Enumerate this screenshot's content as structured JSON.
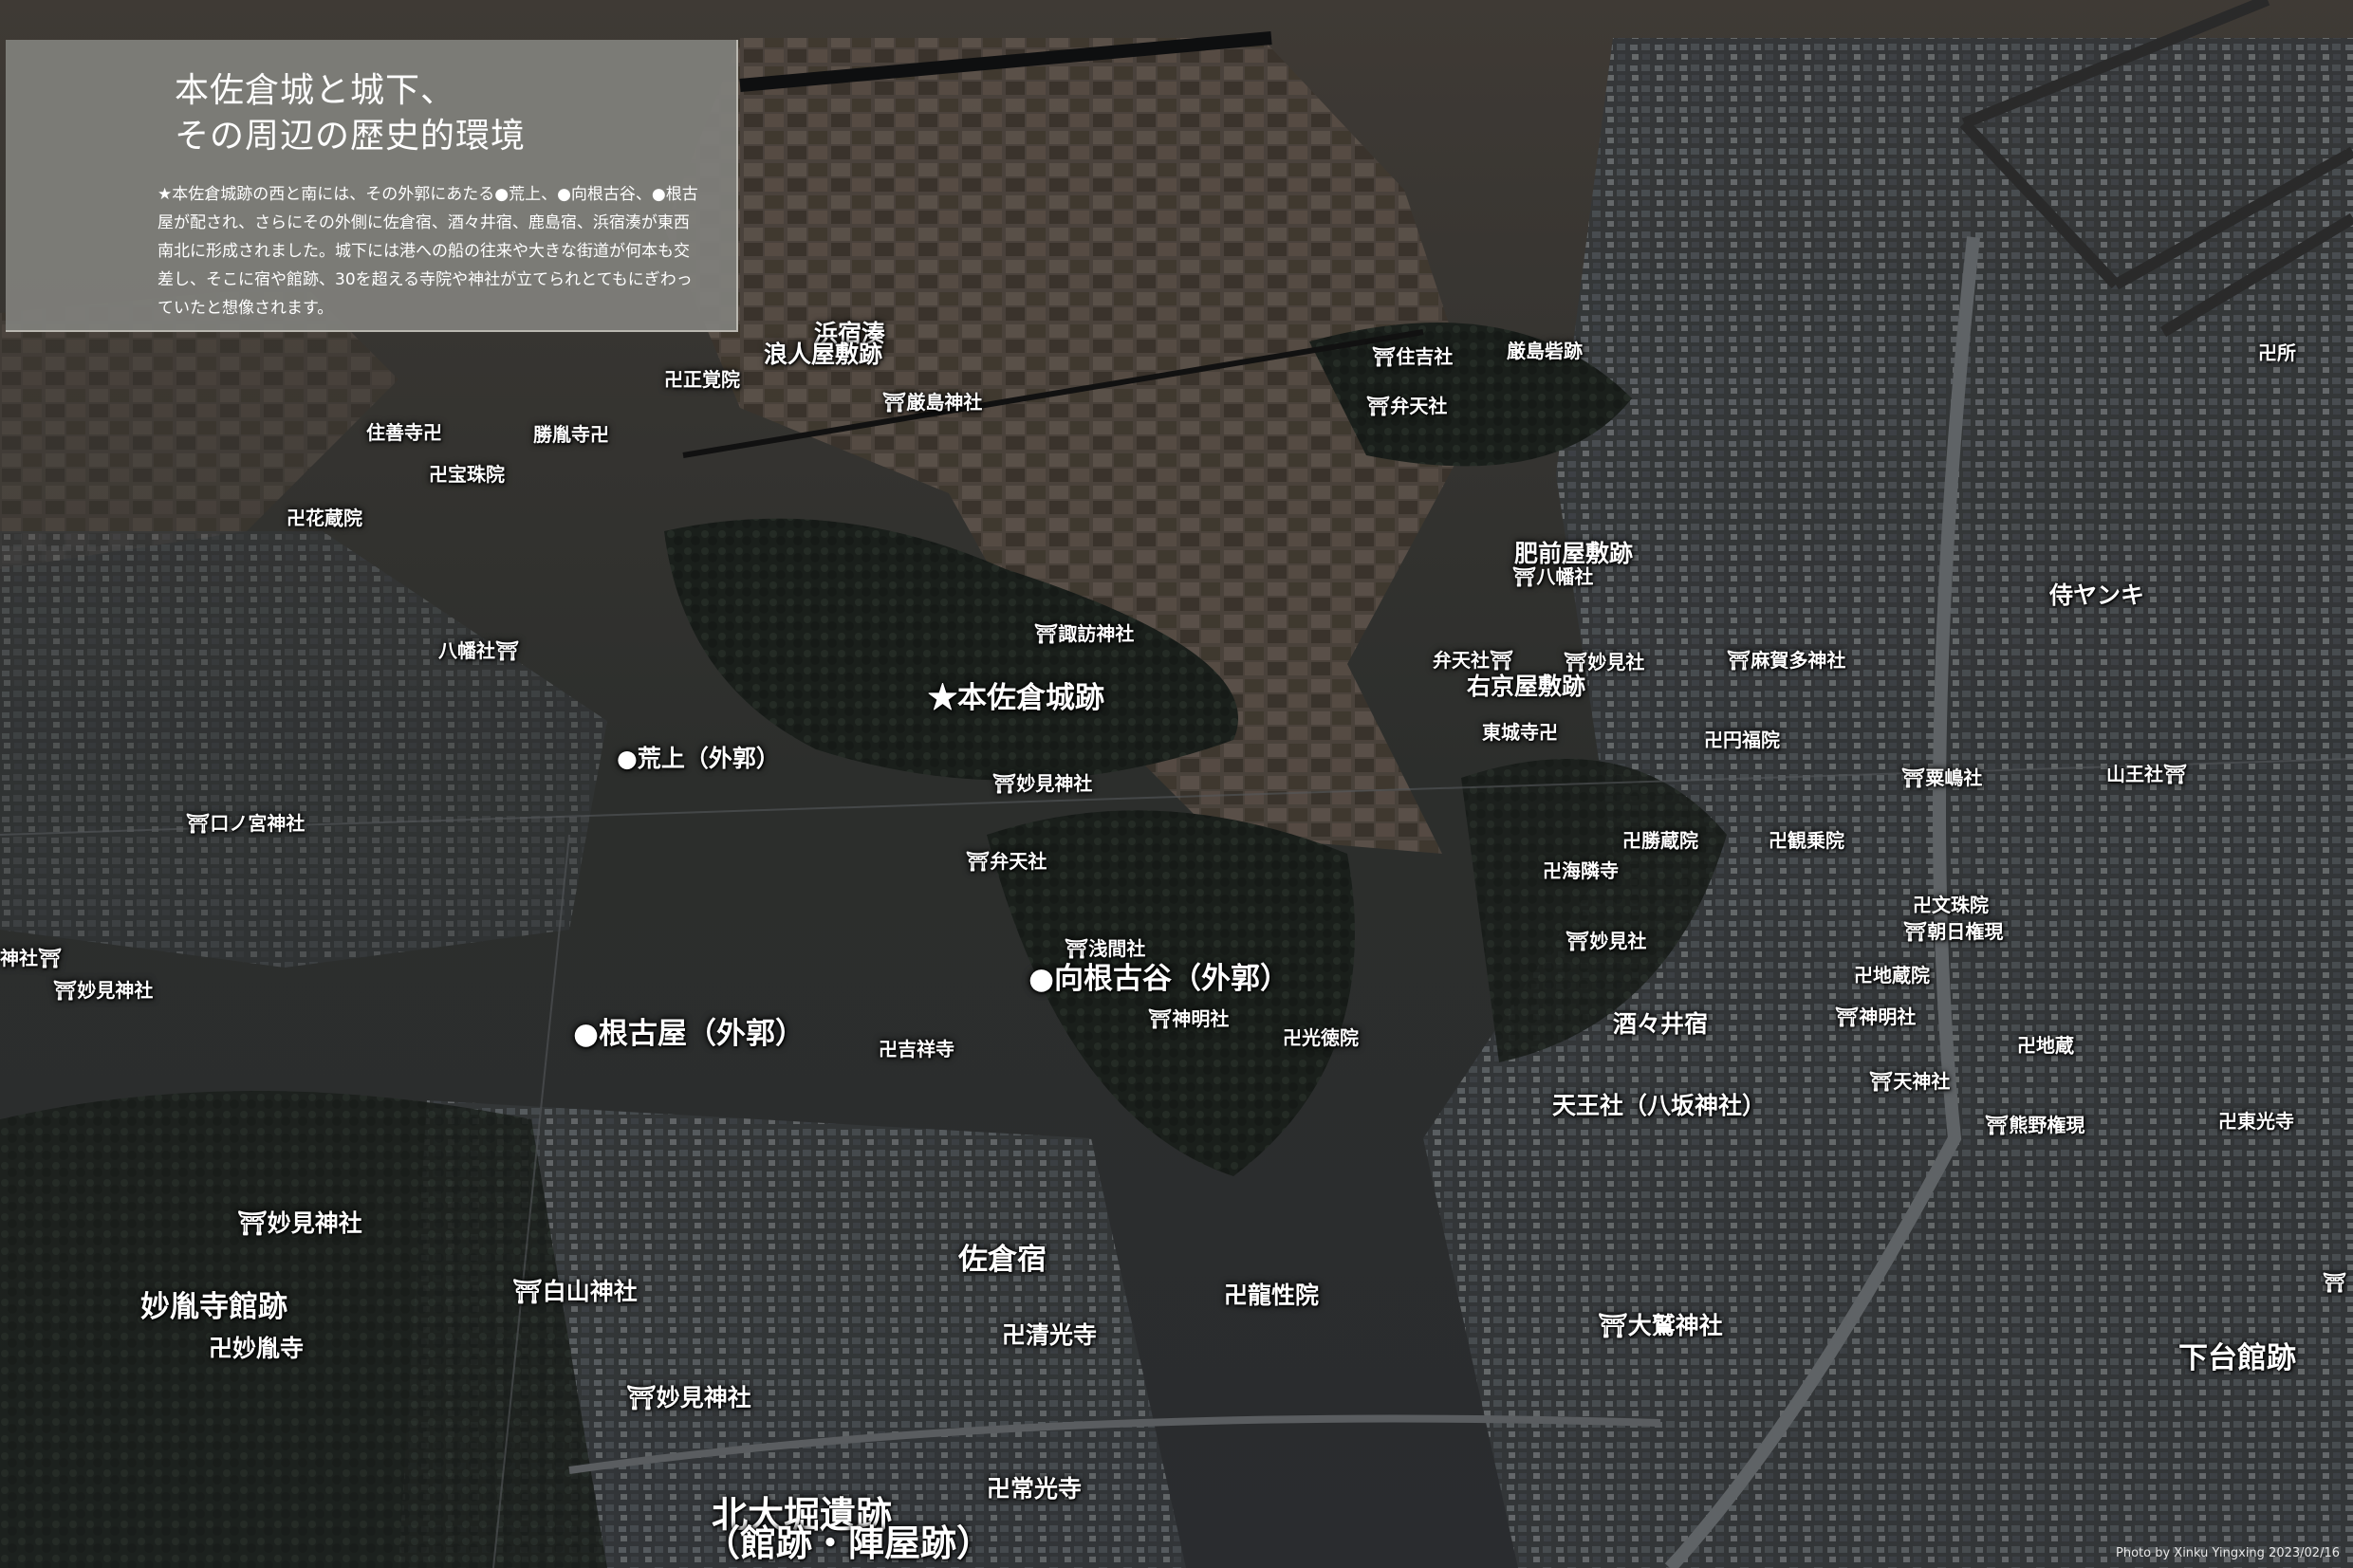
{
  "panel": {
    "title_lines": [
      "本佐倉城と城下、",
      "その周辺の歴史的環境"
    ],
    "body": "★本佐倉城跡の西と南には、その外郭にあたる●荒上、●向根古谷、●根古屋が配され、さらにその外側に佐倉宿、酒々井宿、鹿島宿、浜宿湊が東西南北に形成されました。城下には港への船の往来や大きな街道が何本も交差し、そこに宿や館跡、30を超える寺院や神社が立てられとてもにぎわっていたと想像されます。"
  },
  "labels": {
    "hamajuku_minato": "浜宿湊",
    "ronin_yashiki": "浪人屋敷跡",
    "shoukakuin": "卍正覚院",
    "itsukushima_jinja": "⛩厳島神社",
    "sumiyoshi_sha": "⛩住吉社",
    "itsukushima_toride": "厳島砦跡",
    "benten_sha_n": "⛩弁天社",
    "shozen_ji": "住善寺卍",
    "shoinji_n": "勝胤寺卍",
    "hozuin": "卍宝珠院",
    "kezoin": "卍花蔵院",
    "hizenya_yashiki": "肥前屋敷跡",
    "hachiman_sha_e": "⛩八幡社",
    "hachiman_sha_w": "八幡社⛩",
    "suwa_jinja": "⛩諏訪神社",
    "motosakura_jo": "★本佐倉城跡",
    "benten_sha_e": "弁天社⛩",
    "myoken_sha_e": "⛩妙見社",
    "maga_tamo": "⛩麻賀多神社",
    "ukyoya_yashiki": "右京屋敷跡",
    "tojoji": "東城寺卍",
    "enpukuin": "卍円福院",
    "samurai_yanki": "侍ヤンキ",
    "arakami": "●荒上（外郭）",
    "myoken_jinja_c": "⛩妙見神社",
    "awashima_sha": "⛩粟嶋社",
    "sanno_sha": "山王社⛩",
    "kuchinomiya": "⛩口ノ宮神社",
    "benten_sha_s": "⛩弁天社",
    "shozoin": "卍勝蔵院",
    "kanjoin": "卍観乗院",
    "kairinji": "卍海隣寺",
    "jinja_w": "神社⛩",
    "myoken_jinja_w": "⛩妙見神社",
    "sengen_sha": "⛩浅間社",
    "monjuin": "卍文珠院",
    "asahi_gongen": "⛩朝日権現",
    "myoken_sha_s": "⛩妙見社",
    "mukai_negoya": "●向根古谷（外郭）",
    "jizoin": "卍地蔵院",
    "negoya": "●根古屋（外郭）",
    "shinmei_sha": "⛩神明社",
    "shinmei_sha_e": "⛩神明社",
    "koutokuin": "卍光徳院",
    "shuzui_shuku": "酒々井宿",
    "kichijoji": "卍吉祥寺",
    "jizo_e": "卍地蔵",
    "tenjin_sha": "⛩天神社",
    "tenno_sha": "天王社（八坂神社）",
    "kumano_gongen": "⛩熊野権現",
    "tokoji": "卍東光寺",
    "myoken_jinja_sw": "⛩妙見神社",
    "sakura_shuku": "佐倉宿",
    "hakusan_jinja": "⛩白山神社",
    "ryushoin": "卍龍性院",
    "myoinji_yakata": "妙胤寺館跡",
    "myoinji": "卍妙胤寺",
    "seikoji": "卍清光寺",
    "owashi_jinja": "⛩大鷲神社",
    "shimodai_yakata": "下台館跡",
    "myoken_jinja_bottom": "⛩妙見神社",
    "jokoji": "卍常光寺",
    "kitaohori": "北大堀遺跡",
    "kitaohori_sub": "（館跡・陣屋跡）",
    "east_edge": "⛩",
    "east_edge2": "卍所"
  },
  "credit": "Photo by Xinku Yingxing  2023/02/16"
}
